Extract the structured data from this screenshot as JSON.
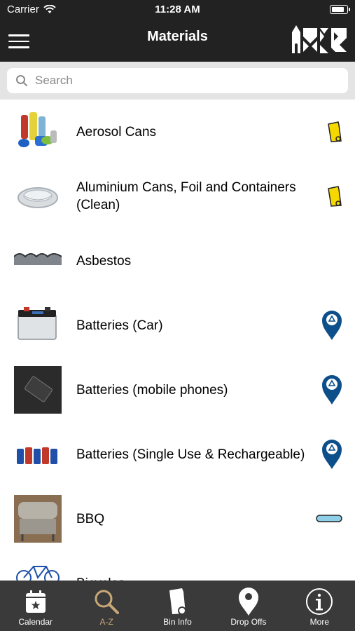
{
  "status": {
    "carrier": "Carrier",
    "time": "11:28 AM"
  },
  "navbar": {
    "title": "Materials",
    "menu_icon": "hamburger-icon",
    "logo": "council-logo"
  },
  "search": {
    "placeholder": "Search"
  },
  "items": [
    {
      "label": "Aerosol Cans",
      "badge": "yellow-bin-icon"
    },
    {
      "label": "Aluminium Cans, Foil and Containers (Clean)",
      "badge": "yellow-bin-icon"
    },
    {
      "label": "Asbestos",
      "badge": ""
    },
    {
      "label": "Batteries (Car)",
      "badge": "recycling-drop-off-pin-icon"
    },
    {
      "label": "Batteries (mobile phones)",
      "badge": "recycling-drop-off-pin-icon"
    },
    {
      "label": "Batteries (Single Use & Rechargeable)",
      "badge": "recycling-drop-off-pin-icon"
    },
    {
      "label": "BBQ",
      "badge": "bulky-waste-bar-icon"
    },
    {
      "label": "Bicycles",
      "badge": ""
    }
  ],
  "tabs": [
    {
      "label": "Calendar",
      "icon": "calendar-icon"
    },
    {
      "label": "A-Z",
      "icon": "magnifier-icon",
      "active": true
    },
    {
      "label": "Bin Info",
      "icon": "bin-icon"
    },
    {
      "label": "Drop Offs",
      "icon": "location-pin-icon"
    },
    {
      "label": "More",
      "icon": "info-icon"
    }
  ],
  "colors": {
    "bar": "#222222",
    "tabbar": "#3a3a3a",
    "active_tab": "#c9a878",
    "yellow_bin": "#f5d800",
    "pin_blue": "#0d4f8a",
    "bar_blue": "#8fd0e8"
  }
}
